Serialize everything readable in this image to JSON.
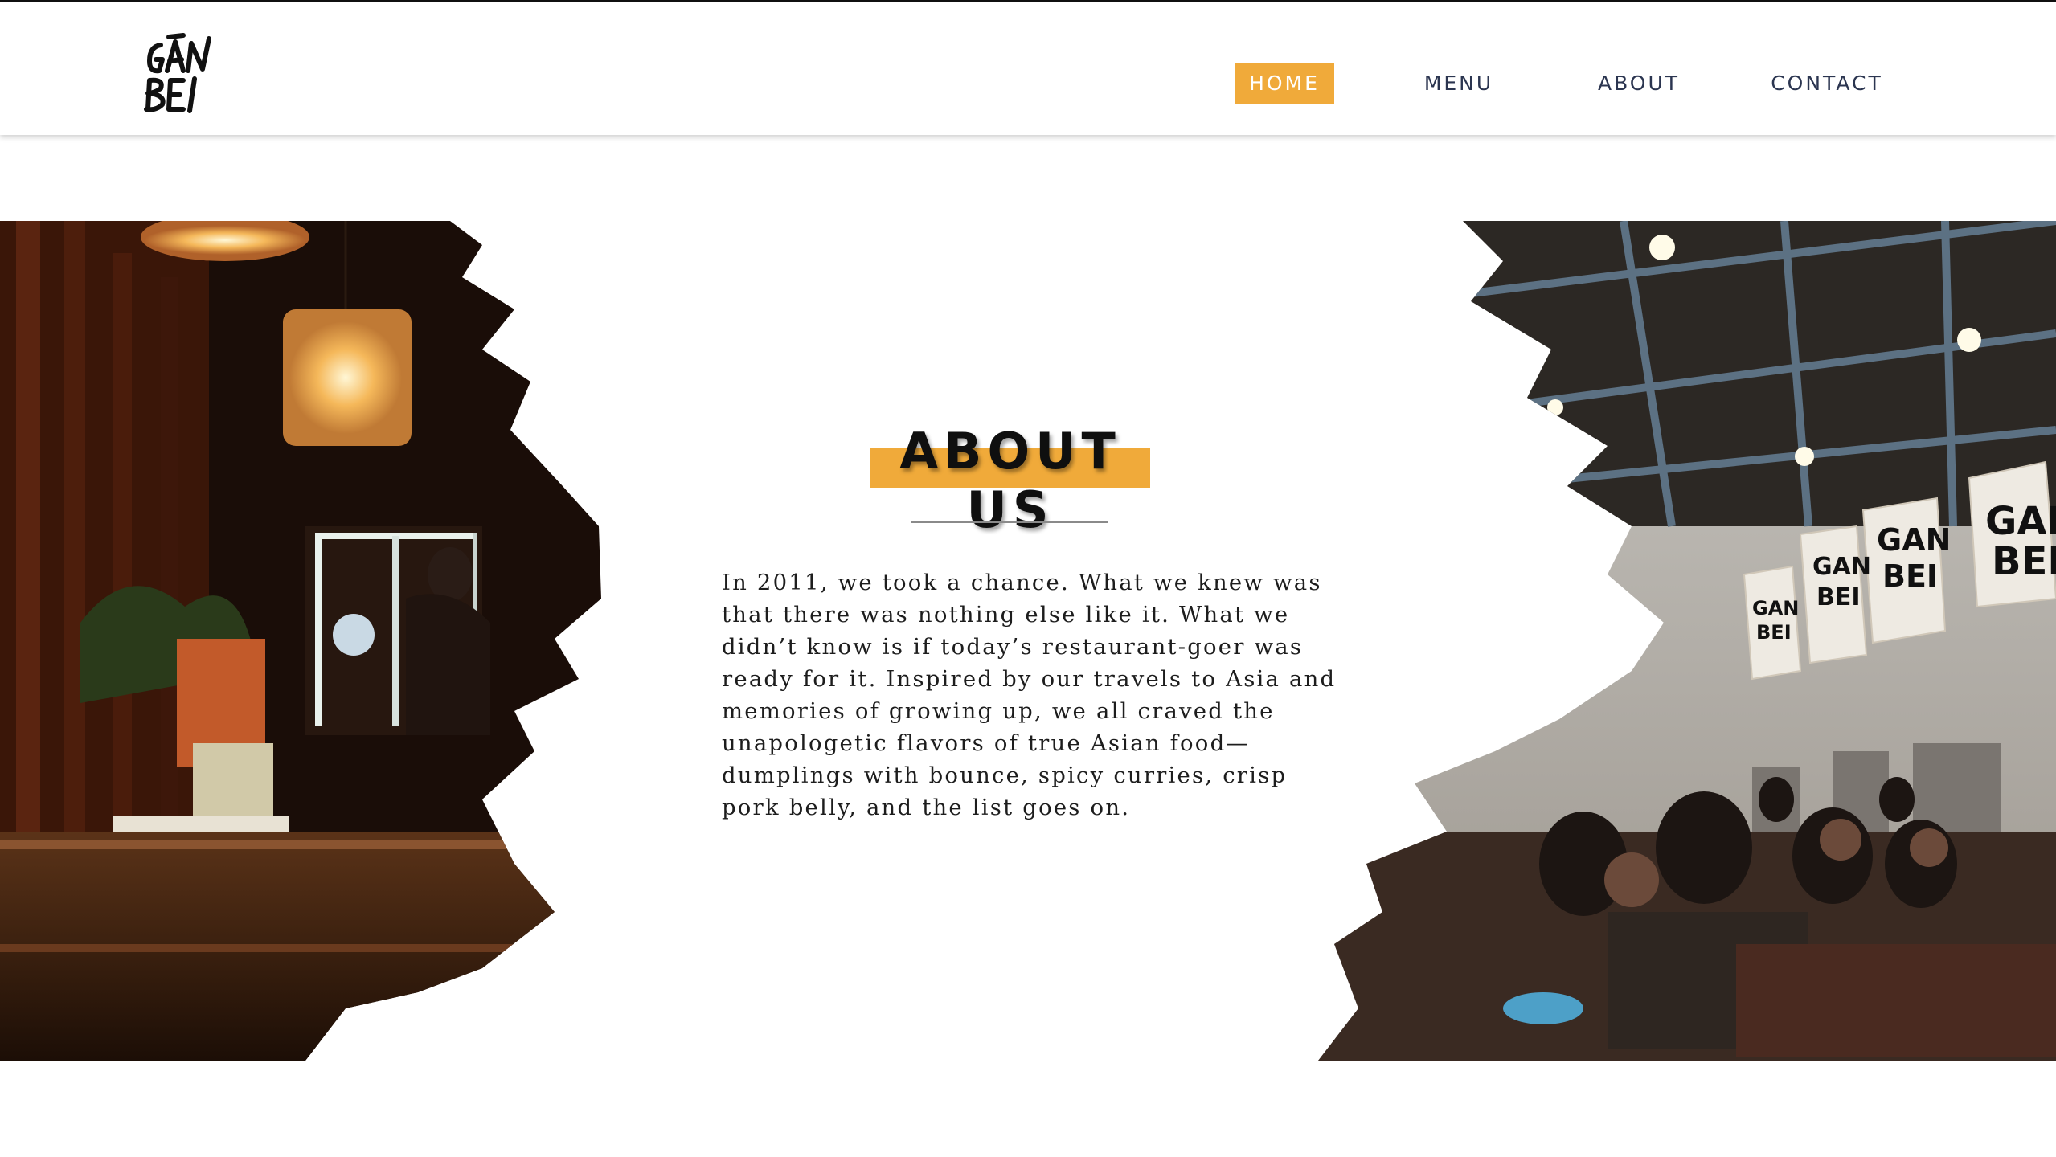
{
  "brand": {
    "logo_text": "GAN BEI"
  },
  "nav": {
    "items": [
      {
        "label": "HOME",
        "active": true
      },
      {
        "label": "MENU",
        "active": false
      },
      {
        "label": "ABOUT",
        "active": false
      },
      {
        "label": "CONTACT",
        "active": false
      }
    ]
  },
  "about": {
    "title": "ABOUT US",
    "body": "In 2011, we took a chance. What we knew was that there was nothing else like it. What we didn’t know is if today’s restaurant-goer was ready for it. Inspired by our travels to Asia and memories of growing up, we all craved the unapologetic flavors of true Asian food—dumplings with bounce, spicy curries, crisp pork belly, and the list goes on."
  },
  "images": {
    "left": "restaurant bar interior with pendant lamps",
    "right": "restaurant dining room with diners and Gan Bei banners"
  },
  "colors": {
    "accent": "#f0aa3a",
    "nav_text": "#2b3550",
    "heading": "#0f0f0f"
  }
}
